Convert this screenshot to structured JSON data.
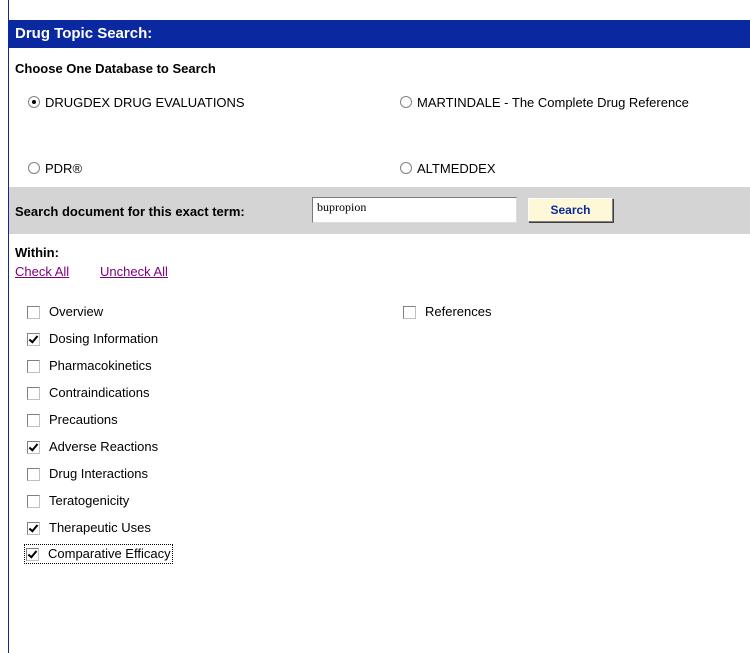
{
  "title": "Drug Topic Search:",
  "database_heading": "Choose One Database to Search",
  "databases": [
    {
      "label": "DRUGDEX DRUG EVALUATIONS",
      "selected": true
    },
    {
      "label": "MARTINDALE - The Complete Drug Reference",
      "selected": false
    },
    {
      "label": "PDR®",
      "selected": false
    },
    {
      "label": "ALTMEDDEX",
      "selected": false
    }
  ],
  "search": {
    "label": "Search document for this exact term:",
    "value": "bupropion",
    "button_label": "Search"
  },
  "within": {
    "label": "Within:",
    "check_all": "Check All",
    "uncheck_all": "Uncheck All"
  },
  "sections": [
    {
      "label": "Overview",
      "checked": false
    },
    {
      "label": "Dosing Information",
      "checked": true
    },
    {
      "label": "Pharmacokinetics",
      "checked": false
    },
    {
      "label": "Contraindications",
      "checked": false
    },
    {
      "label": "Precautions",
      "checked": false
    },
    {
      "label": "Adverse Reactions",
      "checked": true
    },
    {
      "label": "Drug Interactions",
      "checked": false
    },
    {
      "label": "Teratogenicity",
      "checked": false
    },
    {
      "label": "Therapeutic Uses",
      "checked": true
    },
    {
      "label": "Comparative Efficacy",
      "checked": true
    }
  ],
  "sections_right": [
    {
      "label": "References",
      "checked": false
    }
  ],
  "colors": {
    "title_bar": "#0a29a0",
    "search_band": "#d4d4d4",
    "link": "#800080"
  }
}
